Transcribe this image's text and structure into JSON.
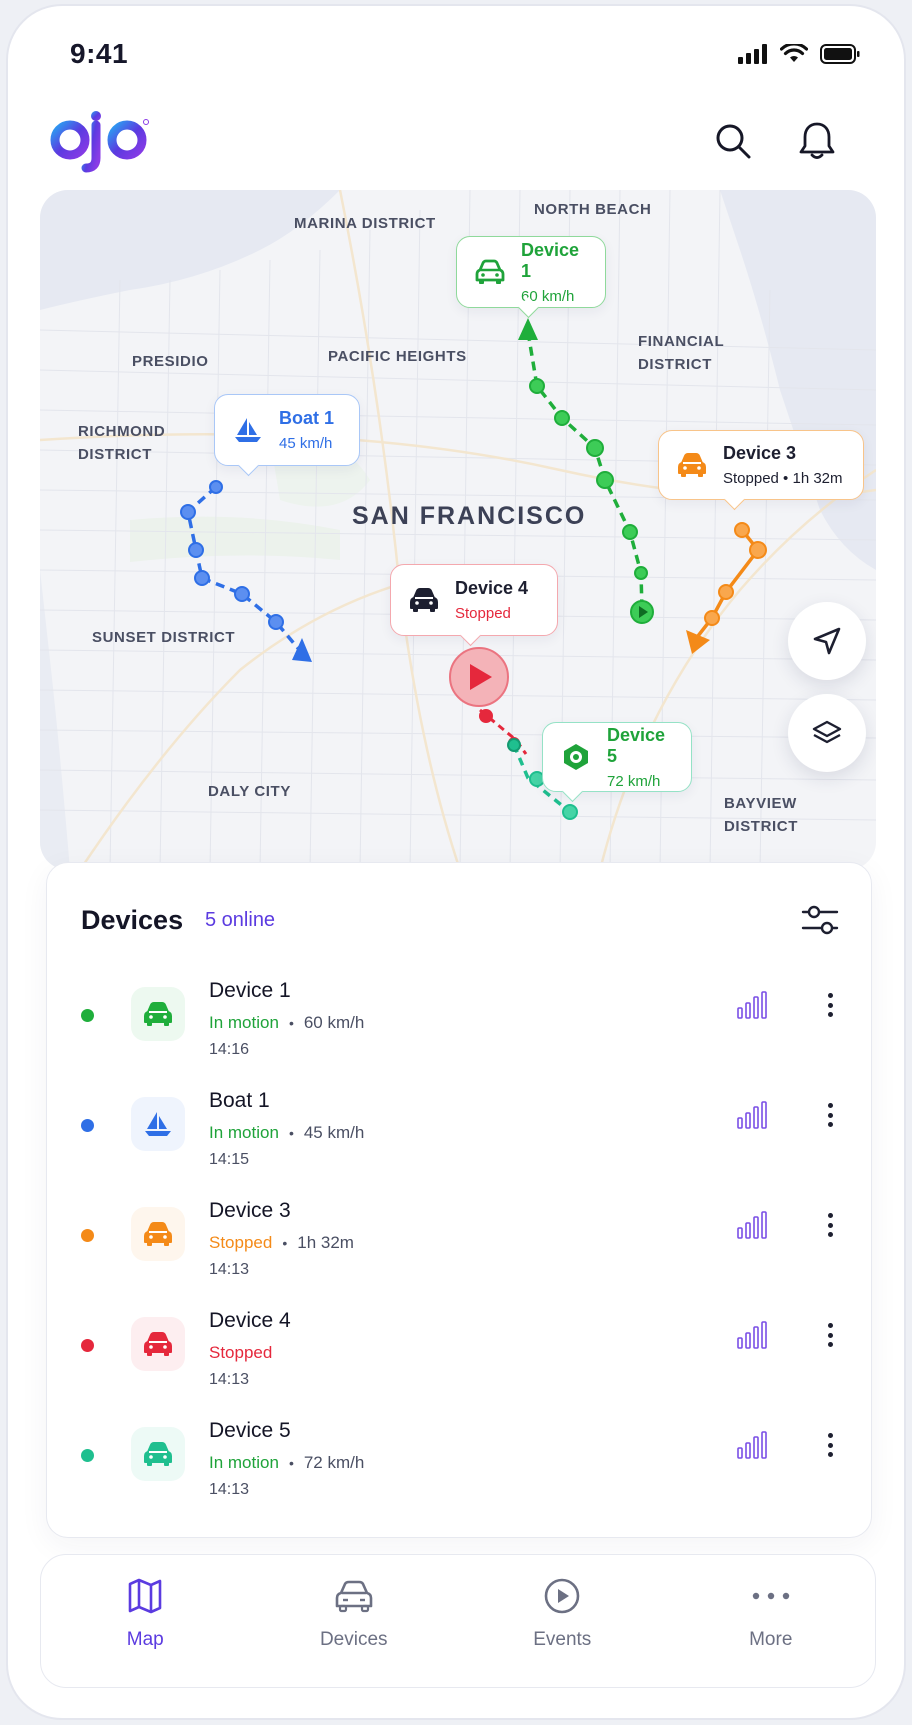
{
  "status_bar": {
    "time": "9:41"
  },
  "app": {
    "logo_text": "ojo",
    "brand_color": "#5b3be0"
  },
  "map": {
    "city": "SAN FRANCISCO",
    "districts": {
      "marina": "MARINA DISTRICT",
      "north_beach": "NORTH BEACH",
      "presidio": "PRESIDIO",
      "pacific_heights": "PACIFIC HEIGHTS",
      "financial_1": "FINANCIAL",
      "financial_2": "DISTRICT",
      "richmond_1": "RICHMOND",
      "richmond_2": "DISTRICT",
      "sunset": "SUNSET DISTRICT",
      "daly_city": "DALY CITY",
      "bayview_1": "BAYVIEW",
      "bayview_2": "DISTRICT"
    },
    "callouts": {
      "device1": {
        "title": "Device 1",
        "sub": "60 km/h",
        "color": "#1fa33a"
      },
      "boat1": {
        "title": "Boat 1",
        "sub": "45 km/h",
        "color": "#2f6fe6"
      },
      "device3": {
        "title": "Device 3",
        "sub": "Stopped • 1h 32m",
        "color": "#1d1f30"
      },
      "device4": {
        "title": "Device 4",
        "sub": "Stopped",
        "color": "#e5283c"
      },
      "device5": {
        "title": "Device 5",
        "sub": "72 km/h",
        "color": "#1fa33a"
      }
    }
  },
  "devices_panel": {
    "title": "Devices",
    "online": "5 online",
    "items": [
      {
        "name": "Device 1",
        "status": "In motion",
        "meta": "60 km/h",
        "time": "14:16",
        "color": "#1fae3b",
        "icon": "car-icon",
        "status_color": "#1fa33a"
      },
      {
        "name": "Boat 1",
        "status": "In motion",
        "meta": "45 km/h",
        "time": "14:15",
        "color": "#2f6fe6",
        "icon": "boat-icon",
        "status_color": "#1fa33a"
      },
      {
        "name": "Device 3",
        "status": "Stopped",
        "meta": "1h 32m",
        "time": "14:13",
        "color": "#f48a18",
        "icon": "car-icon",
        "status_color": "#f48a18"
      },
      {
        "name": "Device 4",
        "status": "Stopped",
        "meta": "",
        "time": "14:13",
        "color": "#e5283c",
        "icon": "car-icon",
        "status_color": "#e5283c"
      },
      {
        "name": "Device 5",
        "status": "In motion",
        "meta": "72 km/h",
        "time": "14:13",
        "color": "#1fbf8f",
        "icon": "car-icon",
        "status_color": "#1fa33a"
      }
    ]
  },
  "bottom_nav": {
    "items": [
      {
        "label": "Map",
        "icon": "map-icon",
        "active": true
      },
      {
        "label": "Devices",
        "icon": "car-icon",
        "active": false
      },
      {
        "label": "Events",
        "icon": "play-icon",
        "active": false
      },
      {
        "label": "More",
        "icon": "more-icon",
        "active": false
      }
    ]
  }
}
